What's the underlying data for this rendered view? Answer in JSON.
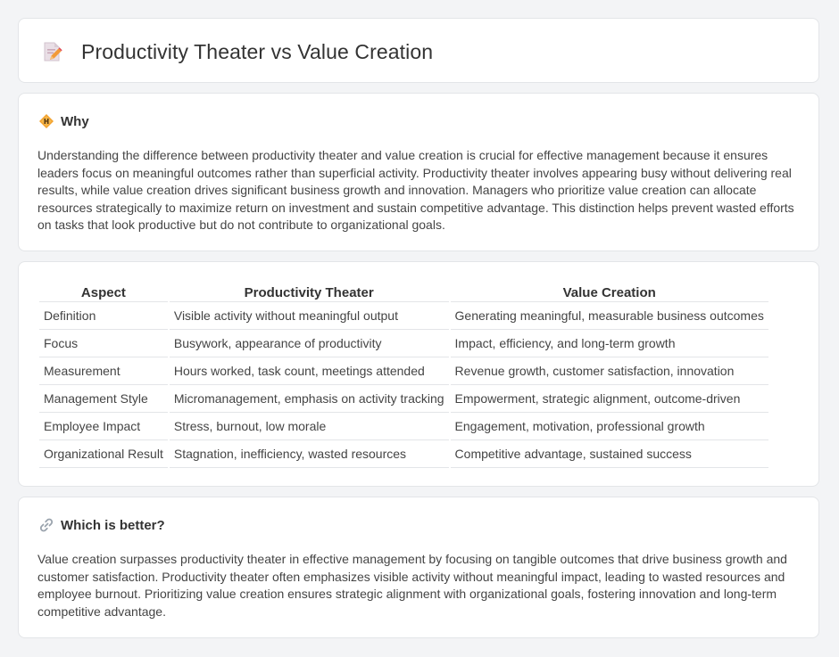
{
  "header": {
    "title": "Productivity Theater vs Value Creation",
    "icon": "document-pencil-icon"
  },
  "why": {
    "title": "Why",
    "icon": "diamond-sign-icon",
    "body": "Understanding the difference between productivity theater and value creation is crucial for effective management because it ensures leaders focus on meaningful outcomes rather than superficial activity. Productivity theater involves appearing busy without delivering real results, while value creation drives significant business growth and innovation. Managers who prioritize value creation can allocate resources strategically to maximize return on investment and sustain competitive advantage. This distinction helps prevent wasted efforts on tasks that look productive but do not contribute to organizational goals."
  },
  "table": {
    "headers": [
      "Aspect",
      "Productivity Theater",
      "Value Creation"
    ],
    "rows": [
      [
        "Definition",
        "Visible activity without meaningful output",
        "Generating meaningful, measurable business outcomes"
      ],
      [
        "Focus",
        "Busywork, appearance of productivity",
        "Impact, efficiency, and long-term growth"
      ],
      [
        "Measurement",
        "Hours worked, task count, meetings attended",
        "Revenue growth, customer satisfaction, innovation"
      ],
      [
        "Management Style",
        "Micromanagement, emphasis on activity tracking",
        "Empowerment, strategic alignment, outcome-driven"
      ],
      [
        "Employee Impact",
        "Stress, burnout, low morale",
        "Engagement, motivation, professional growth"
      ],
      [
        "Organizational Result",
        "Stagnation, inefficiency, wasted resources",
        "Competitive advantage, sustained success"
      ]
    ]
  },
  "better": {
    "title": "Which is better?",
    "icon": "link-icon",
    "body": "Value creation surpasses productivity theater in effective management by focusing on tangible outcomes that drive business growth and customer satisfaction. Productivity theater often emphasizes visible activity without meaningful impact, leading to wasted resources and employee burnout. Prioritizing value creation ensures strategic alignment with organizational goals, fostering innovation and long-term competitive advantage."
  },
  "colors": {
    "background": "#f3f4f6",
    "card": "#ffffff",
    "border": "#e3e5e8",
    "text": "#333333",
    "icon_accent": "#f0a030"
  }
}
